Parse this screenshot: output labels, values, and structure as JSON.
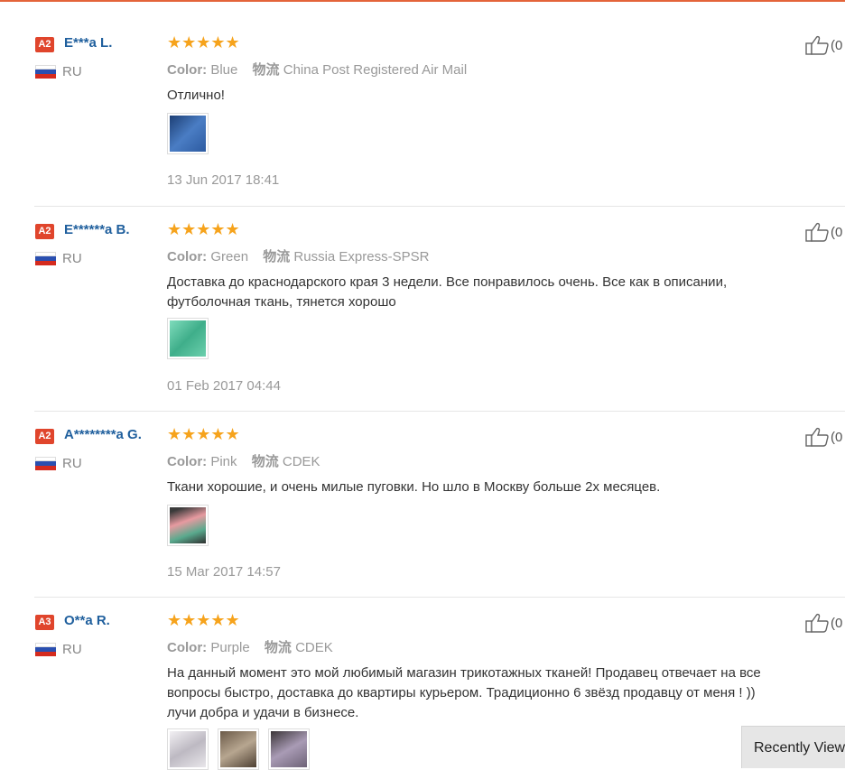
{
  "labels": {
    "color": "Color:",
    "logistics": "物流"
  },
  "reviews": [
    {
      "badge": "A2",
      "name": "E***a L.",
      "country": "RU",
      "stars": "★★★★★",
      "color": "Blue",
      "shipping": "China Post Registered Air Mail",
      "text": "Отлично!",
      "date": "13 Jun 2017 18:41",
      "likes": "(0",
      "photo_colors": [
        "#2e5d9b"
      ]
    },
    {
      "badge": "A2",
      "name": "E******a B.",
      "country": "RU",
      "stars": "★★★★★",
      "color": "Green",
      "shipping": "Russia Express-SPSR",
      "text": "Доставка до краснодарского края 3 недели. Все понравилось очень. Все как в описании, футболочная ткань, тянется хорошо",
      "date": "01 Feb 2017 04:44",
      "likes": "(0",
      "photo_colors": [
        "#5fc4a3"
      ]
    },
    {
      "badge": "A2",
      "name": "A********a G.",
      "country": "RU",
      "stars": "★★★★★",
      "color": "Pink",
      "shipping": "CDEK",
      "text": "Ткани хорошие, и очень милые пуговки. Но шло в Москву больше 2х месяцев.",
      "date": "15 Mar 2017 14:57",
      "likes": "(0",
      "photo_colors": [
        "#d98a8e"
      ]
    },
    {
      "badge": "A3",
      "name": "O**a R.",
      "country": "RU",
      "stars": "★★★★★",
      "color": "Purple",
      "shipping": "CDEK",
      "text": "На данный момент это мой любимый магазин трикотажных тканей! Продавец отвечает на все вопросы быстро, доставка до квартиры курьером. Традиционно 6 звёзд продавцу от меня ! )) лучи добра и удачи в бизнесе.",
      "date": "",
      "likes": "(0",
      "photo_colors": [
        "#c9c6cc",
        "#8b7a6a",
        "#9a8fa8"
      ]
    }
  ],
  "recently_viewed": "Recently Viewed"
}
